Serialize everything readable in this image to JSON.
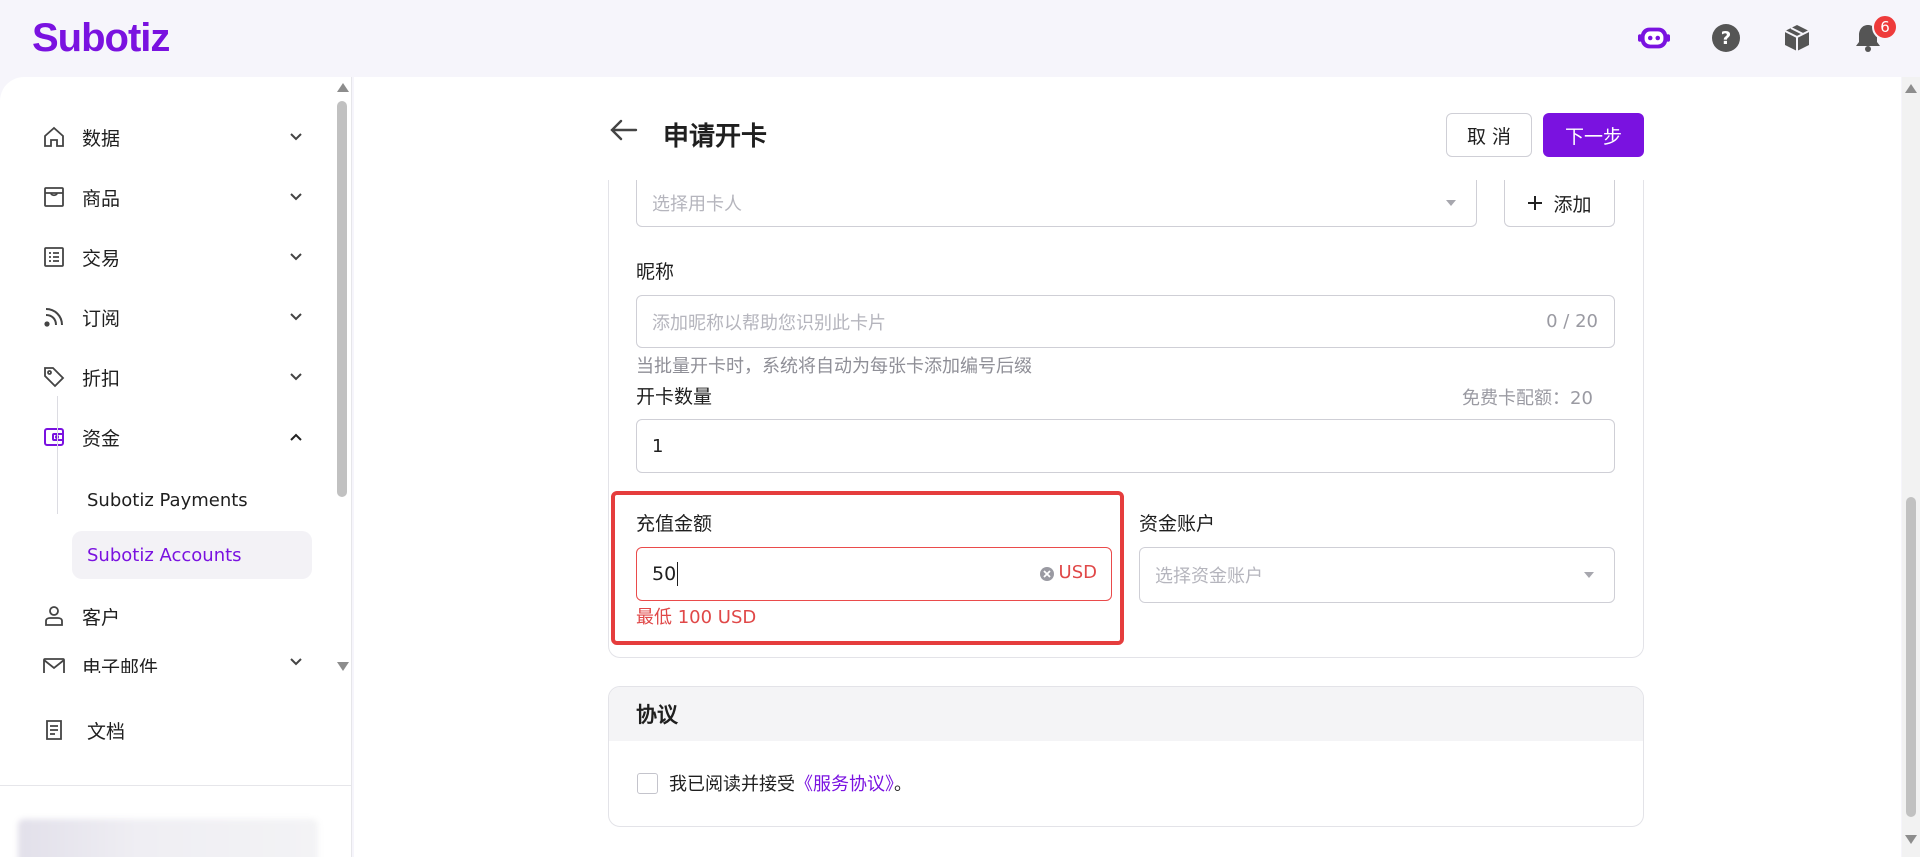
{
  "app": {
    "logo": "Subotiz"
  },
  "topbar": {
    "notification_count": "6"
  },
  "sidebar": {
    "items": [
      {
        "label": "数据",
        "icon": "home-icon"
      },
      {
        "label": "商品",
        "icon": "store-icon"
      },
      {
        "label": "交易",
        "icon": "list-icon"
      },
      {
        "label": "订阅",
        "icon": "rss-icon"
      },
      {
        "label": "折扣",
        "icon": "tag-icon"
      },
      {
        "label": "资金",
        "icon": "wallet-icon"
      },
      {
        "label": "客户",
        "icon": "user-icon"
      },
      {
        "label": "电子邮件",
        "icon": "mail-icon"
      },
      {
        "label": "文档",
        "icon": "document-icon"
      }
    ],
    "sub_items": [
      {
        "label": "Subotiz Payments"
      },
      {
        "label": "Subotiz Accounts"
      }
    ]
  },
  "header": {
    "title": "申请开卡",
    "cancel_label": "取 消",
    "next_label": "下一步"
  },
  "form": {
    "cardholder_placeholder": "选择用卡人",
    "add_label": "添加",
    "nickname_label": "昵称",
    "nickname_placeholder": "添加昵称以帮助您识别此卡片",
    "nickname_counter": "0 / 20",
    "batch_hint": "当批量开卡时，系统将自动为每张卡添加编号后缀",
    "quantity_label": "开卡数量",
    "free_quota": "免费卡配额：20",
    "quantity_value": "1",
    "amount_label": "充值金额",
    "amount_value": "50",
    "amount_unit": "USD",
    "amount_error": "最低 100 USD",
    "account_label": "资金账户",
    "account_placeholder": "选择资金账户"
  },
  "agreement": {
    "title": "协议",
    "text_prefix": "我已阅读并接受",
    "link": "《服务协议》",
    "text_suffix": "。"
  },
  "colors": {
    "brand": "#7a12e0",
    "error": "#e53d3d"
  }
}
